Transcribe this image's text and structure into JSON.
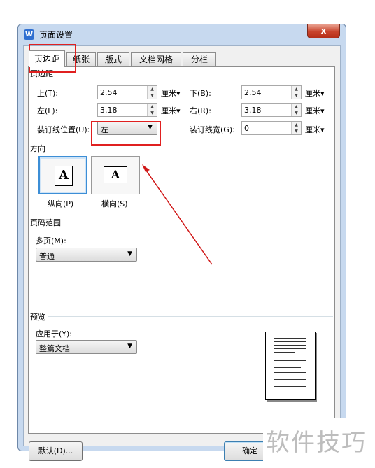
{
  "window": {
    "title": "页面设置",
    "close_label": "x"
  },
  "tabs": [
    {
      "label": "页边距",
      "active": true
    },
    {
      "label": "纸张"
    },
    {
      "label": "版式"
    },
    {
      "label": "文档网格"
    },
    {
      "label": "分栏"
    }
  ],
  "margins": {
    "section_title": "页边距",
    "top": {
      "label": "上(T):",
      "value": "2.54",
      "unit": "厘米▾"
    },
    "bottom": {
      "label": "下(B):",
      "value": "2.54",
      "unit": "厘米▾"
    },
    "left": {
      "label": "左(L):",
      "value": "3.18",
      "unit": "厘米▾"
    },
    "right": {
      "label": "右(R):",
      "value": "3.18",
      "unit": "厘米▾"
    },
    "gutter_position": {
      "label": "装订线位置(U):",
      "value": "左"
    },
    "gutter_width": {
      "label": "装订线宽(G):",
      "value": "0",
      "unit": "厘米▾"
    }
  },
  "orientation": {
    "section_title": "方向",
    "portrait": {
      "label": "纵向(P)",
      "glyph": "A",
      "selected": true
    },
    "landscape": {
      "label": "横向(S)",
      "glyph": "A"
    }
  },
  "page_range": {
    "section_title": "页码范围",
    "multi_label": "多页(M):",
    "multi_value": "普通"
  },
  "preview": {
    "section_title": "预览",
    "apply_label": "应用于(Y):",
    "apply_value": "整篇文档"
  },
  "buttons": {
    "default": "默认(D)...",
    "ok": "确定"
  },
  "watermark": "软件技巧",
  "colors": {
    "highlight": "#e02020",
    "arrow": "#d01818",
    "selected_border": "#3c8ed6"
  }
}
